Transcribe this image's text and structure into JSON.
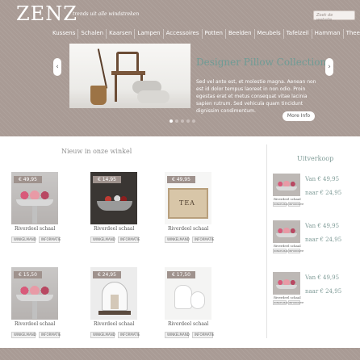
{
  "header": {
    "logo": "ZENZ",
    "tagline": "trends uit alle windstreken",
    "search_placeholder": "Zoek de website..."
  },
  "nav": {
    "items": [
      "Kussens",
      "Schalen",
      "Kaarsen",
      "Lampen",
      "Accessoires",
      "Potten",
      "Beelden",
      "Meubels",
      "Tafelzeil",
      "Hamman",
      "Thee"
    ]
  },
  "slider": {
    "title": "Designer Pillow Collection",
    "text": "Sed vel ante est, et molestie magna. Aenean non est id dolor tempus laoreet in non odio. Proin egestas erat et metus consequat vitae lacinia sapien rutrum. Sed vehicula quam tincidunt dignissim condimentum.",
    "more_label": "More Info",
    "prev_label": "‹",
    "next_label": "›",
    "dot_count": 5,
    "active_dot": 0
  },
  "main": {
    "section_title": "Nieuw in onze winkel",
    "cart_label": "WINKELMAND",
    "info_label": "INFORMATIE",
    "products": [
      {
        "price": "€ 49,95",
        "name": "Riverdeel schaal"
      },
      {
        "price": "€ 14,95",
        "name": "Riverdeel schaal"
      },
      {
        "price": "€ 49,95",
        "name": "Riverdeel schaal"
      },
      {
        "price": "€ 15,50",
        "name": "Riverdeel schaal"
      },
      {
        "price": "€ 24,95",
        "name": "Riverdeel schaal"
      },
      {
        "price": "€ 17,50",
        "name": "Riverdeel schaal"
      }
    ]
  },
  "sidebar": {
    "title": "Uitverkoop",
    "cart_label": "WINKELMAND",
    "info_label": "INFORMATIE",
    "items": [
      {
        "name": "Riverdeel schaal",
        "was": "Van € 49,95",
        "now": "naar € 24,95"
      },
      {
        "name": "Riverdeel schaal",
        "was": "Van € 49,95",
        "now": "naar € 24,95"
      },
      {
        "name": "Riverdeel schaal",
        "was": "Van € 49,95",
        "now": "naar € 24,95"
      }
    ]
  },
  "colors": {
    "background": "#a99b95",
    "accent": "#7f9b97",
    "price_tag": "#9f928d"
  }
}
